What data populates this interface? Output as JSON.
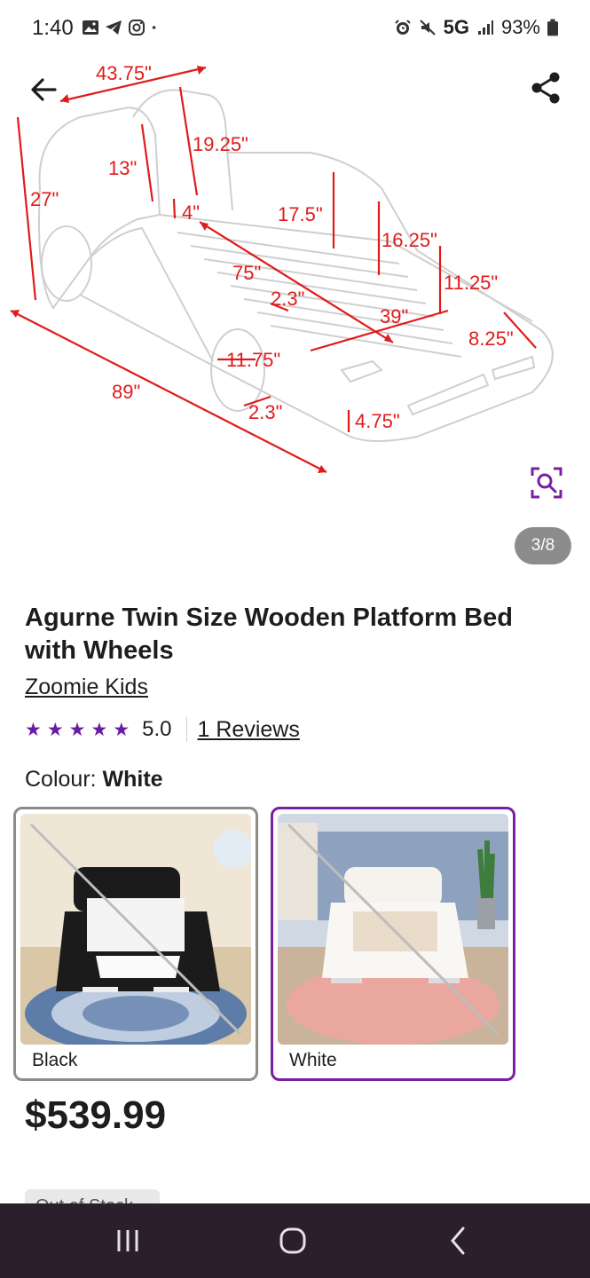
{
  "status_bar": {
    "time": "1:40",
    "network": "5G",
    "battery": "93%",
    "left_icons": [
      "gallery-icon",
      "telegram-icon",
      "instagram-icon",
      "dot-icon"
    ],
    "right_icons": [
      "alarm-icon",
      "mute-icon",
      "signal-icon",
      "battery-icon"
    ]
  },
  "gallery": {
    "counter": "3/8",
    "dimension_labels": [
      "43.75\"",
      "19.25\"",
      "13\"",
      "27\"",
      "4\"",
      "17.5\"",
      "16.25\"",
      "75\"",
      "11.25\"",
      "2.3\"",
      "39\"",
      "8.25\"",
      "11.75\"",
      "89\"",
      "2.3\"",
      "4.75\""
    ]
  },
  "product": {
    "title": "Agurne Twin Size Wooden Platform Bed with Wheels",
    "brand": "Zoomie Kids",
    "rating_value": "5.0",
    "rating_stars": 5,
    "reviews_label": "1 Reviews",
    "colour_label": "Colour:",
    "colour_value": "White",
    "swatches": [
      {
        "label": "Black"
      },
      {
        "label": "White"
      }
    ],
    "price": "$539.99",
    "stock_label": "Out of Stock"
  },
  "colors": {
    "accent": "#7b1fa2",
    "star": "#6b1aa4",
    "dimension_red": "#e01b1b",
    "nav_bar": "#2a1f2b"
  }
}
